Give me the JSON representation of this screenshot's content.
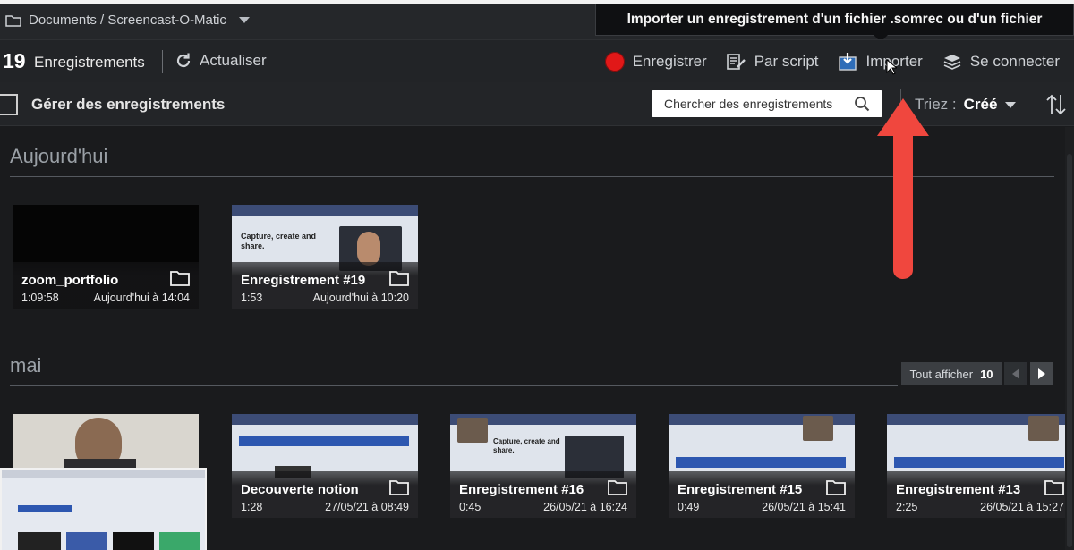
{
  "window": {
    "breadcrumb": "Documents / Screencast-O-Matic"
  },
  "tooltip": {
    "text": "Importer un enregistrement d'un fichier .somrec ou d'un fichier"
  },
  "toolbar": {
    "count": "19",
    "count_label": "Enregistrements",
    "refresh_label": "Actualiser",
    "record_label": "Enregistrer",
    "script_label": "Par script",
    "import_label": "Importer",
    "signin_label": "Se connecter"
  },
  "manage": {
    "label": "Gérer des enregistrements",
    "search_placeholder": "Chercher des enregistrements",
    "sort_label": "Triez :",
    "sort_value": "Créé"
  },
  "sections": [
    {
      "title": "Aujourd'hui",
      "recordings": [
        {
          "title": "zoom_portfolio",
          "duration": "1:09:58",
          "date": "Aujourd'hui à 14:04"
        },
        {
          "title": "Enregistrement #19",
          "duration": "1:53",
          "date": "Aujourd'hui à 10:20"
        }
      ]
    },
    {
      "title": "mai",
      "show_all_label": "Tout afficher",
      "show_all_count": "10",
      "recordings": [
        {
          "title": "",
          "duration": "",
          "date": ""
        },
        {
          "title": "Decouverte notion",
          "duration": "1:28",
          "date": "27/05/21 à 08:49"
        },
        {
          "title": "Enregistrement #16",
          "duration": "0:45",
          "date": "26/05/21 à 16:24"
        },
        {
          "title": "Enregistrement #15",
          "duration": "0:49",
          "date": "26/05/21 à 15:41"
        },
        {
          "title": "Enregistrement #13",
          "duration": "2:25",
          "date": "26/05/21 à 15:27"
        }
      ]
    }
  ],
  "thumbnail_text": {
    "line1": "Capture, create and",
    "line2": "share."
  },
  "colors": {
    "record": "#e11818",
    "annotation_arrow": "#f0473e",
    "background": "#1a1b1d"
  }
}
